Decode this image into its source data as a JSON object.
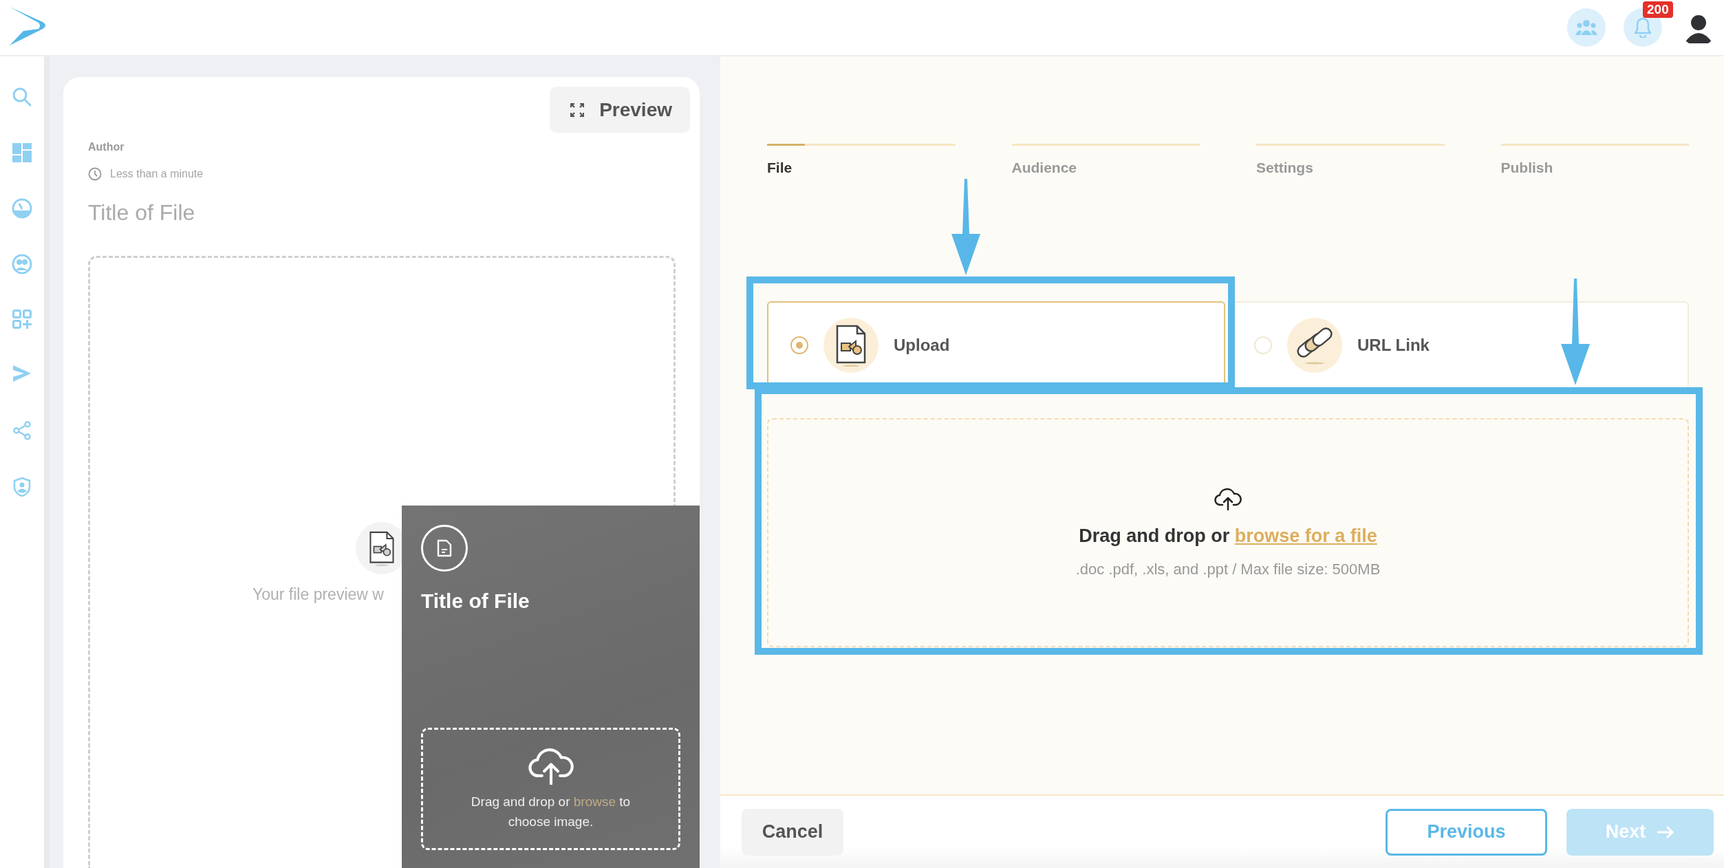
{
  "header": {
    "notification_count": "200"
  },
  "preview": {
    "button": "Preview",
    "author": "Author",
    "read_time": "Less than a minute",
    "title": "Title of File",
    "placeholder_text": "Your file preview w"
  },
  "cover_card": {
    "title": "Title of File",
    "drop_prefix": "Drag and drop or",
    "drop_link": "browse",
    "drop_suffix": "to choose image."
  },
  "steps": [
    {
      "label": "File",
      "selected": true,
      "level": 0.2
    },
    {
      "label": "Audience",
      "selected": false,
      "level": 0
    },
    {
      "label": "Settings",
      "selected": false,
      "level": 0
    },
    {
      "label": "Publish",
      "selected": false,
      "level": 0
    }
  ],
  "source_options": [
    {
      "kind": "upload",
      "label": "Upload",
      "selected": true
    },
    {
      "kind": "url",
      "label": "URL Link",
      "selected": false
    }
  ],
  "dropzone": {
    "prompt": "Drag and drop or",
    "link": "browse for a file",
    "hint": ".doc .pdf, .xls, and .ppt / Max file size: 500MB"
  },
  "footer": {
    "cancel": "Cancel",
    "previous": "Previous",
    "next": "Next",
    "next_disabled": true
  }
}
